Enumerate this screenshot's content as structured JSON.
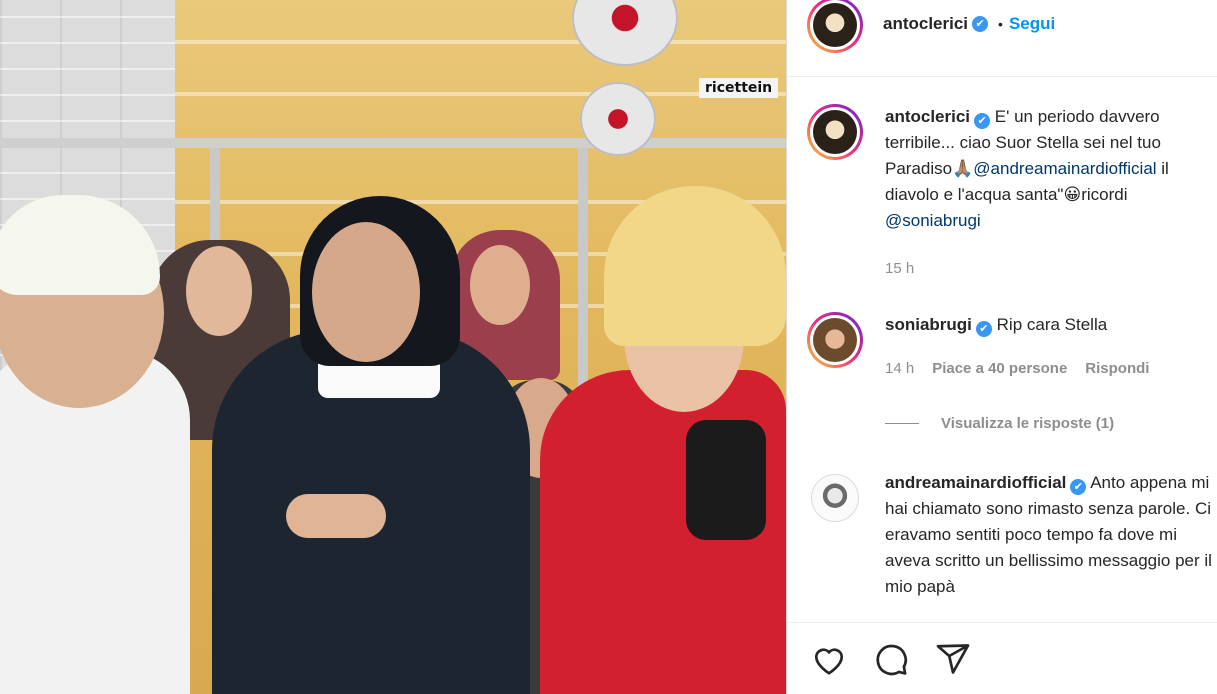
{
  "post_image": {
    "overlay_text": "ricettein"
  },
  "header": {
    "username": "antoclerici",
    "verified_mark": "✔",
    "separator": "•",
    "follow_label": "Segui"
  },
  "caption": {
    "username": "antoclerici",
    "text_1": "E' un periodo davvero terribile... ciao Suor Stella sei nel tuo Paradiso",
    "emoji_1": "🙏🏽",
    "mention_1": "@andreamainardiofficial",
    "text_2": " il diavolo e l'acqua santa\"",
    "emoji_2": "😀",
    "text_3": "ricordi ",
    "mention_2": "@soniabrugi",
    "time": "15 h"
  },
  "comments": [
    {
      "username": "soniabrugi",
      "text": "Rip cara Stella",
      "time": "14 h",
      "likes": "Piace a 40 persone",
      "reply": "Rispondi"
    },
    {
      "username": "andreamainardiofficial",
      "text": "Anto appena mi hai chiamato sono rimasto senza parole. Ci eravamo sentiti poco tempo fa dove mi aveva scritto un bellissimo messaggio per il mio papà"
    }
  ],
  "view_replies": "Visualizza le risposte (1)",
  "icons": {
    "like": "heart-icon",
    "comment": "comment-icon",
    "share": "paper-plane-icon"
  },
  "colors": {
    "link": "#0095f6",
    "mention": "#00376b",
    "verified": "#3897f0",
    "muted": "#8e8e8e"
  }
}
